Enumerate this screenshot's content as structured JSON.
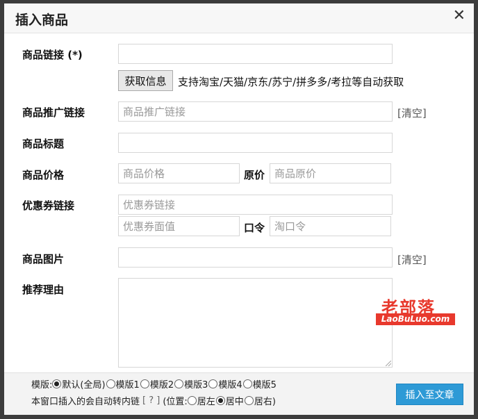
{
  "dialog": {
    "title": "插入商品",
    "close_symbol": "✕"
  },
  "fields": {
    "product_link": {
      "label": "商品链接 (*)",
      "value": "",
      "placeholder": ""
    },
    "fetch_button": "获取信息",
    "fetch_hint": "支持淘宝/天猫/京东/苏宁/拼多多/考拉等自动获取",
    "promo_link": {
      "label": "商品推广链接",
      "placeholder": "商品推广链接",
      "clear": "[清空]"
    },
    "title": {
      "label": "商品标题",
      "placeholder": ""
    },
    "price": {
      "label": "商品价格",
      "placeholder": "商品价格",
      "original_label": "原价",
      "original_placeholder": "商品原价"
    },
    "coupon": {
      "label": "优惠券链接",
      "link_placeholder": "优惠券链接",
      "value_placeholder": "优惠券面值",
      "code_label": "口令",
      "code_placeholder": "淘口令"
    },
    "image": {
      "label": "商品图片",
      "placeholder": "",
      "clear": "[清空]"
    },
    "reason": {
      "label": "推荐理由",
      "placeholder": ""
    }
  },
  "watermark": {
    "cn": "老部落",
    "en": "LaoBuLuo.com"
  },
  "footer": {
    "template_label": "模版:",
    "templates": [
      "默认(全局)",
      "模版1",
      "模版2",
      "模版3",
      "模版4",
      "模版5"
    ],
    "template_selected": "默认(全局)",
    "notice": "本窗口插入的会自动转内链",
    "help": "[ ? ]",
    "position_label": "(位置:",
    "positions": [
      "居左",
      "居中",
      "居右)"
    ],
    "position_selected": "居中",
    "insert_button": "插入至文章"
  },
  "colors": {
    "accent": "#2e9ad6",
    "watermark": "#e8392d"
  }
}
